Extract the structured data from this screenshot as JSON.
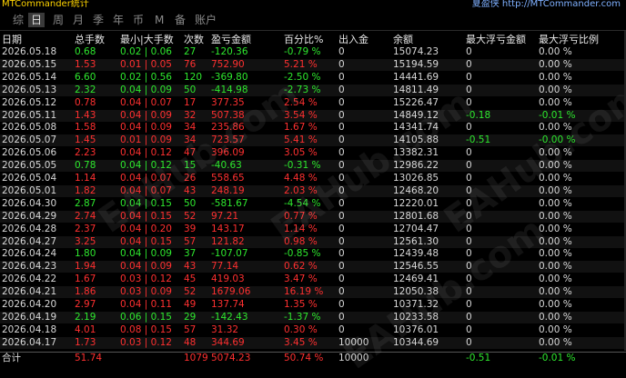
{
  "titlebar": {
    "app": "MTCommander统计",
    "link": "夏盈侠 http://MTCommander.com"
  },
  "tabs": [
    "综",
    "日",
    "周",
    "月",
    "季",
    "年",
    "币",
    "M",
    "备",
    "账户"
  ],
  "active_tab": 1,
  "columns": [
    "日期",
    "总手数",
    "最小|大手数",
    "次数",
    "盈亏金额",
    "百分比%",
    "出入金",
    "余额",
    "最大浮亏金额",
    "最大浮亏比例"
  ],
  "rows": [
    [
      "2026.05.18",
      "0.68",
      "0.02 | 0.06",
      "27",
      "-120.36",
      "-0.79 %",
      "0",
      "15074.23",
      "0",
      "0.00 %"
    ],
    [
      "2026.05.15",
      "1.53",
      "0.01 | 0.05",
      "76",
      "752.90",
      "5.21 %",
      "0",
      "15194.59",
      "0",
      "0.00 %"
    ],
    [
      "2026.05.14",
      "6.60",
      "0.02 | 0.56",
      "120",
      "-369.80",
      "-2.50 %",
      "0",
      "14441.69",
      "0",
      "0.00 %"
    ],
    [
      "2026.05.13",
      "2.32",
      "0.04 | 0.09",
      "50",
      "-414.98",
      "-2.73 %",
      "0",
      "14811.49",
      "0",
      "0.00 %"
    ],
    [
      "2026.05.12",
      "0.78",
      "0.04 | 0.07",
      "17",
      "377.35",
      "2.54 %",
      "0",
      "15226.47",
      "0",
      "0.00 %"
    ],
    [
      "2026.05.11",
      "1.43",
      "0.04 | 0.09",
      "32",
      "507.38",
      "3.54 %",
      "0",
      "14849.12",
      "-0.18",
      "-0.01 %"
    ],
    [
      "2026.05.08",
      "1.58",
      "0.04 | 0.09",
      "34",
      "235.86",
      "1.67 %",
      "0",
      "14341.74",
      "0",
      "0.00 %"
    ],
    [
      "2026.05.07",
      "1.45",
      "0.01 | 0.09",
      "34",
      "723.57",
      "5.41 %",
      "0",
      "14105.88",
      "-0.51",
      "-0.00 %"
    ],
    [
      "2026.05.06",
      "2.23",
      "0.04 | 0.12",
      "47",
      "396.09",
      "3.05 %",
      "0",
      "13382.31",
      "0",
      "0.00 %"
    ],
    [
      "2026.05.05",
      "0.78",
      "0.04 | 0.12",
      "15",
      "-40.63",
      "-0.31 %",
      "0",
      "12986.22",
      "0",
      "0.00 %"
    ],
    [
      "2026.05.04",
      "1.14",
      "0.04 | 0.07",
      "26",
      "558.65",
      "4.48 %",
      "0",
      "13026.85",
      "0",
      "0.00 %"
    ],
    [
      "2026.05.01",
      "1.82",
      "0.04 | 0.07",
      "43",
      "248.19",
      "2.03 %",
      "0",
      "12468.20",
      "0",
      "0.00 %"
    ],
    [
      "2026.04.30",
      "2.87",
      "0.04 | 0.15",
      "50",
      "-581.67",
      "-4.54 %",
      "0",
      "12220.01",
      "0",
      "0.00 %"
    ],
    [
      "2026.04.29",
      "2.74",
      "0.04 | 0.15",
      "52",
      "97.21",
      "0.77 %",
      "0",
      "12801.68",
      "0",
      "0.00 %"
    ],
    [
      "2026.04.28",
      "2.37",
      "0.04 | 0.20",
      "39",
      "143.17",
      "1.14 %",
      "0",
      "12704.47",
      "0",
      "0.00 %"
    ],
    [
      "2026.04.27",
      "3.25",
      "0.04 | 0.15",
      "57",
      "121.82",
      "0.98 %",
      "0",
      "12561.30",
      "0",
      "0.00 %"
    ],
    [
      "2026.04.24",
      "1.80",
      "0.04 | 0.09",
      "37",
      "-107.07",
      "-0.85 %",
      "0",
      "12439.48",
      "0",
      "0.00 %"
    ],
    [
      "2026.04.23",
      "1.94",
      "0.04 | 0.09",
      "43",
      "77.14",
      "0.62 %",
      "0",
      "12546.55",
      "0",
      "0.00 %"
    ],
    [
      "2026.04.22",
      "1.67",
      "0.03 | 0.12",
      "45",
      "419.03",
      "3.47 %",
      "0",
      "12469.41",
      "0",
      "0.00 %"
    ],
    [
      "2026.04.21",
      "1.86",
      "0.03 | 0.09",
      "52",
      "1679.06",
      "16.19 %",
      "0",
      "12050.38",
      "0",
      "0.00 %"
    ],
    [
      "2026.04.20",
      "2.97",
      "0.04 | 0.11",
      "49",
      "137.74",
      "1.35 %",
      "0",
      "10371.32",
      "0",
      "0.00 %"
    ],
    [
      "2026.04.19",
      "2.19",
      "0.06 | 0.15",
      "29",
      "-142.43",
      "-1.37 %",
      "0",
      "10233.58",
      "0",
      "0.00 %"
    ],
    [
      "2026.04.18",
      "4.01",
      "0.08 | 0.15",
      "57",
      "31.32",
      "0.30 %",
      "0",
      "10376.01",
      "0",
      "0.00 %"
    ],
    [
      "2026.04.17",
      "1.73",
      "0.03 | 0.12",
      "48",
      "344.69",
      "3.45 %",
      "10000",
      "10344.69",
      "0",
      "0.00 %"
    ]
  ],
  "footer": [
    "合计",
    "51.74",
    "",
    "1079",
    "5074.23",
    "50.74 %",
    "10000",
    "",
    "-0.51",
    "-0.01 %"
  ],
  "watermark": "EAHub.com",
  "colors": {
    "positive": "#2ee82e",
    "negative": "#ff3030",
    "active_tab": "#3a3a3a"
  }
}
